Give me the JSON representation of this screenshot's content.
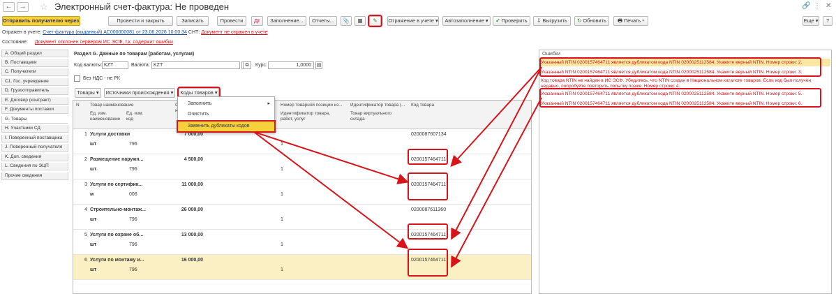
{
  "window": {
    "title": "Электронный счет-фактура: Не проведен",
    "icons": [
      "link-icon",
      "more-icon",
      "close-icon"
    ]
  },
  "toolbar": {
    "send_label": "Отправить получателю через ИС ЭСФ",
    "post_close": "Провести и закрыть",
    "save": "Записать",
    "post": "Провести",
    "fill": "Заполнение...",
    "reports": "Отчеты...",
    "reflect": "Отражение в учете",
    "autofill": "Автозаполнение",
    "check": "Проверить",
    "upload": "Выгрузить",
    "refresh": "Обновить",
    "print": "Печать",
    "more": "Еще",
    "help": "?"
  },
  "info": {
    "reflected_label": "Отражен в учете:",
    "reflected_link": "Счет-фактура (выданный) АС000000081 от 23.06.2026 10:00:34",
    "snt_label": "СНТ:",
    "snt_link": "Документ не отражен в учете",
    "state_label": "Состояние:",
    "state_link": "Документ отклонен сервером ИС ЭСФ, т.к. содержит ошибки"
  },
  "sidebar": [
    {
      "label": "A. Общий раздел"
    },
    {
      "label": "B. Поставщики"
    },
    {
      "label": "C. Получатели"
    },
    {
      "label": "C1. Гос. учреждение"
    },
    {
      "label": "D. Грузоотправитель"
    },
    {
      "label": "E. Договор (контракт)"
    },
    {
      "label": "F. Документы поставки"
    },
    {
      "label": "G. Товары"
    },
    {
      "label": "H. Участники СД"
    },
    {
      "label": "I. Поверенный поставщика"
    },
    {
      "label": "J. Поверенный получателя"
    },
    {
      "label": "K. Доп. сведения"
    },
    {
      "label": "L. Сведения по ЭЦП"
    },
    {
      "label": "Прочие сведения"
    }
  ],
  "section": {
    "title": "Раздел G. Данные по товарам (работам, услугам)",
    "currency_code_label": "Код валюты:",
    "currency_code": "KZT",
    "currency_label": "Валюта:",
    "currency": "KZT",
    "rate_label": "Курс:",
    "rate": "1,0000",
    "no_vat_label": "Без НДС - не РК"
  },
  "grid_toolbar": {
    "goods": "Товары",
    "sources": "Источники происхождения",
    "codes": "Коды товаров"
  },
  "popup": {
    "fill": "Заполнить",
    "clear": "Очистить",
    "replace": "Заменить дубликаты кодов"
  },
  "columns": {
    "n": "N",
    "name": "Товар наименование",
    "unit": "Ед. изм. наименование",
    "unit_code": "Ед. изм. код",
    "sum_short": "С",
    "sum_short2": "н",
    "position": "Номер товарной позиции из...",
    "ident": "Идентификатор товара (...",
    "ident2": "Идентификатор товара, работ, услуг",
    "virtual": "Товар виртуального склада",
    "code": "Код товара"
  },
  "rows": [
    {
      "n": "1",
      "name": "Услуги доставки",
      "unit": "шт",
      "unit_code": "796",
      "sum": "7 000,00",
      "pos": "1",
      "code": "0200087607134"
    },
    {
      "n": "2",
      "name": "Размещение наружн...",
      "unit": "шт",
      "unit_code": "796",
      "sum": "4 500,00",
      "pos": "1",
      "code": "0200157464711"
    },
    {
      "n": "3",
      "name": "Услуги по сертифик...",
      "unit": "м",
      "unit_code": "006",
      "sum": "11 000,00",
      "pos": "1",
      "code": "0200157464711"
    },
    {
      "n": "4",
      "name": "Строительно-монтаж...",
      "unit": "шт",
      "unit_code": "796",
      "sum": "26 000,00",
      "pos": "1",
      "code": "0200087611360"
    },
    {
      "n": "5",
      "name": "Услуги по охране об...",
      "unit": "шт",
      "unit_code": "796",
      "sum": "13 000,00",
      "pos": "1",
      "code": "0200157464711"
    },
    {
      "n": "6",
      "name": "Услуги по монтажу и...",
      "unit": "шт",
      "unit_code": "796",
      "sum": "16 000,00",
      "pos": "1",
      "code": "0200157464711"
    }
  ],
  "errors": {
    "title": "Ошибки",
    "lines": [
      "Указанный NTIN 0200157464711 является дубликатом кода NTIN 0200025112584. Укажите верный NTIN. Номер строки: 2.",
      "Указанный NTIN 0200157464711 является дубликатом кода NTIN 0200025112584. Укажите верный NTIN. Номер строки: 3.",
      "Код товара NTIN не найден в ИС ЭСФ. Убедитесь, что NTIN создан в Национальном каталоге товаров. Если код был получен",
      "недавно, попробуйте повторить попытку позже. Номер строки: 4.",
      "Указанный NTIN 0200157464711 является дубликатом кода NTIN 0200025112584. Укажите верный NTIN. Номер строки: 5.",
      "Указанный NTIN 0200157464711 является дубликатом кода NTIN 0200025112584. Укажите верный NTIN. Номер строки: 6."
    ]
  },
  "colors": {
    "accent": "#f6d13b",
    "error": "#d9131a",
    "link": "#1a4fa0"
  }
}
